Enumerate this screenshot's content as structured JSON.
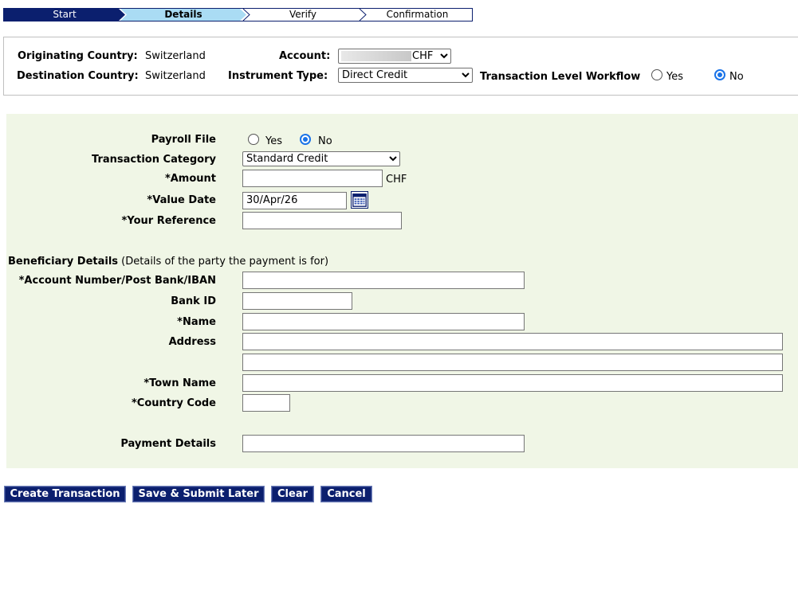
{
  "steps": [
    "Start",
    "Details",
    "Verify",
    "Confirmation"
  ],
  "header": {
    "originating_label": "Originating Country:",
    "originating_value": "Switzerland",
    "destination_label": "Destination Country:",
    "destination_value": "Switzerland",
    "account_label": "Account:",
    "account_currency": "CHF",
    "instrument_label": "Instrument Type:",
    "instrument_value": "Direct Credit",
    "workflow_label": "Transaction Level Workflow",
    "yes_label": "Yes",
    "no_label": "No",
    "workflow_selected": "No"
  },
  "form": {
    "payroll_label": "Payroll File",
    "payroll_yes": "Yes",
    "payroll_no": "No",
    "payroll_selected": "No",
    "category_label": "Transaction Category",
    "category_value": "Standard Credit",
    "amount_label": "*Amount",
    "amount_value": "",
    "currency": "CHF",
    "value_date_label": "*Value Date",
    "value_date_value": "30/Apr/26",
    "reference_label": "*Your Reference",
    "reference_value": ""
  },
  "beneficiary": {
    "section_title": "Beneficiary Details",
    "section_note": "(Details of the party the payment is for)",
    "account_label": "*Account Number/Post Bank/IBAN",
    "bank_id_label": "Bank ID",
    "name_label": "*Name",
    "address_label": "Address",
    "town_label": "*Town Name",
    "country_label": "*Country Code",
    "payment_details_label": "Payment Details"
  },
  "buttons": {
    "create": "Create Transaction",
    "save": "Save & Submit Later",
    "clear": "Clear",
    "cancel": "Cancel"
  },
  "colors": {
    "navy": "#0b1f6e",
    "active_step": "#aadcf4",
    "panel_bg": "#f0f6e6",
    "radio_selected": "#1a73e8"
  }
}
